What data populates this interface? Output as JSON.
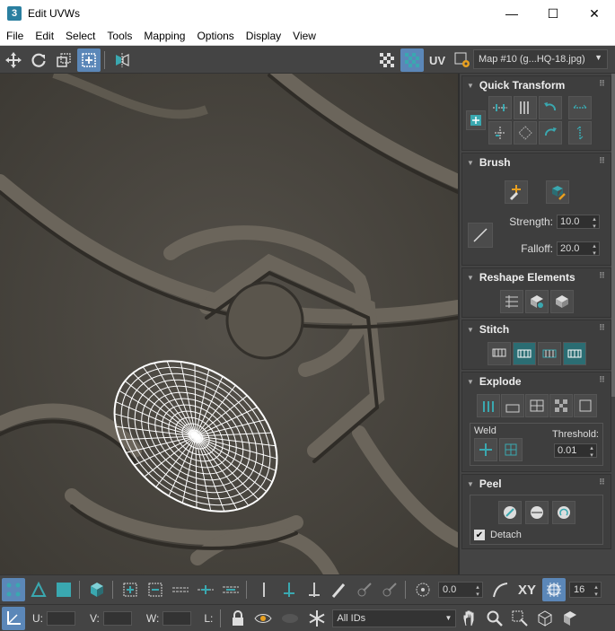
{
  "window": {
    "app_icon": "3",
    "title": "Edit UVWs",
    "minimize": "—",
    "maximize": "☐",
    "close": "✕"
  },
  "menu": [
    "File",
    "Edit",
    "Select",
    "Tools",
    "Mapping",
    "Options",
    "Display",
    "View"
  ],
  "toolbar": {
    "uv_label": "UV",
    "map_select": "Map #10 (g...HQ-18.jpg)"
  },
  "panel": {
    "quick_transform": {
      "title": "Quick Transform"
    },
    "brush": {
      "title": "Brush",
      "strength_label": "Strength:",
      "strength_value": "10.0",
      "falloff_label": "Falloff:",
      "falloff_value": "20.0"
    },
    "reshape": {
      "title": "Reshape Elements"
    },
    "stitch": {
      "title": "Stitch"
    },
    "explode": {
      "title": "Explode",
      "weld_label": "Weld",
      "threshold_label": "Threshold:",
      "threshold_value": "0.01"
    },
    "peel": {
      "title": "Peel",
      "detach_label": "Detach"
    }
  },
  "bottom": {
    "rotate_value": "0.0",
    "xy_label": "XY",
    "grid_value": "16",
    "u_label": "U:",
    "v_label": "V:",
    "w_label": "W:",
    "l_label": "L:",
    "ids_select": "All IDs"
  },
  "colors": {
    "teal": "#3aa8b0",
    "highlight": "#5b87b8",
    "panel_bg": "#444444"
  }
}
